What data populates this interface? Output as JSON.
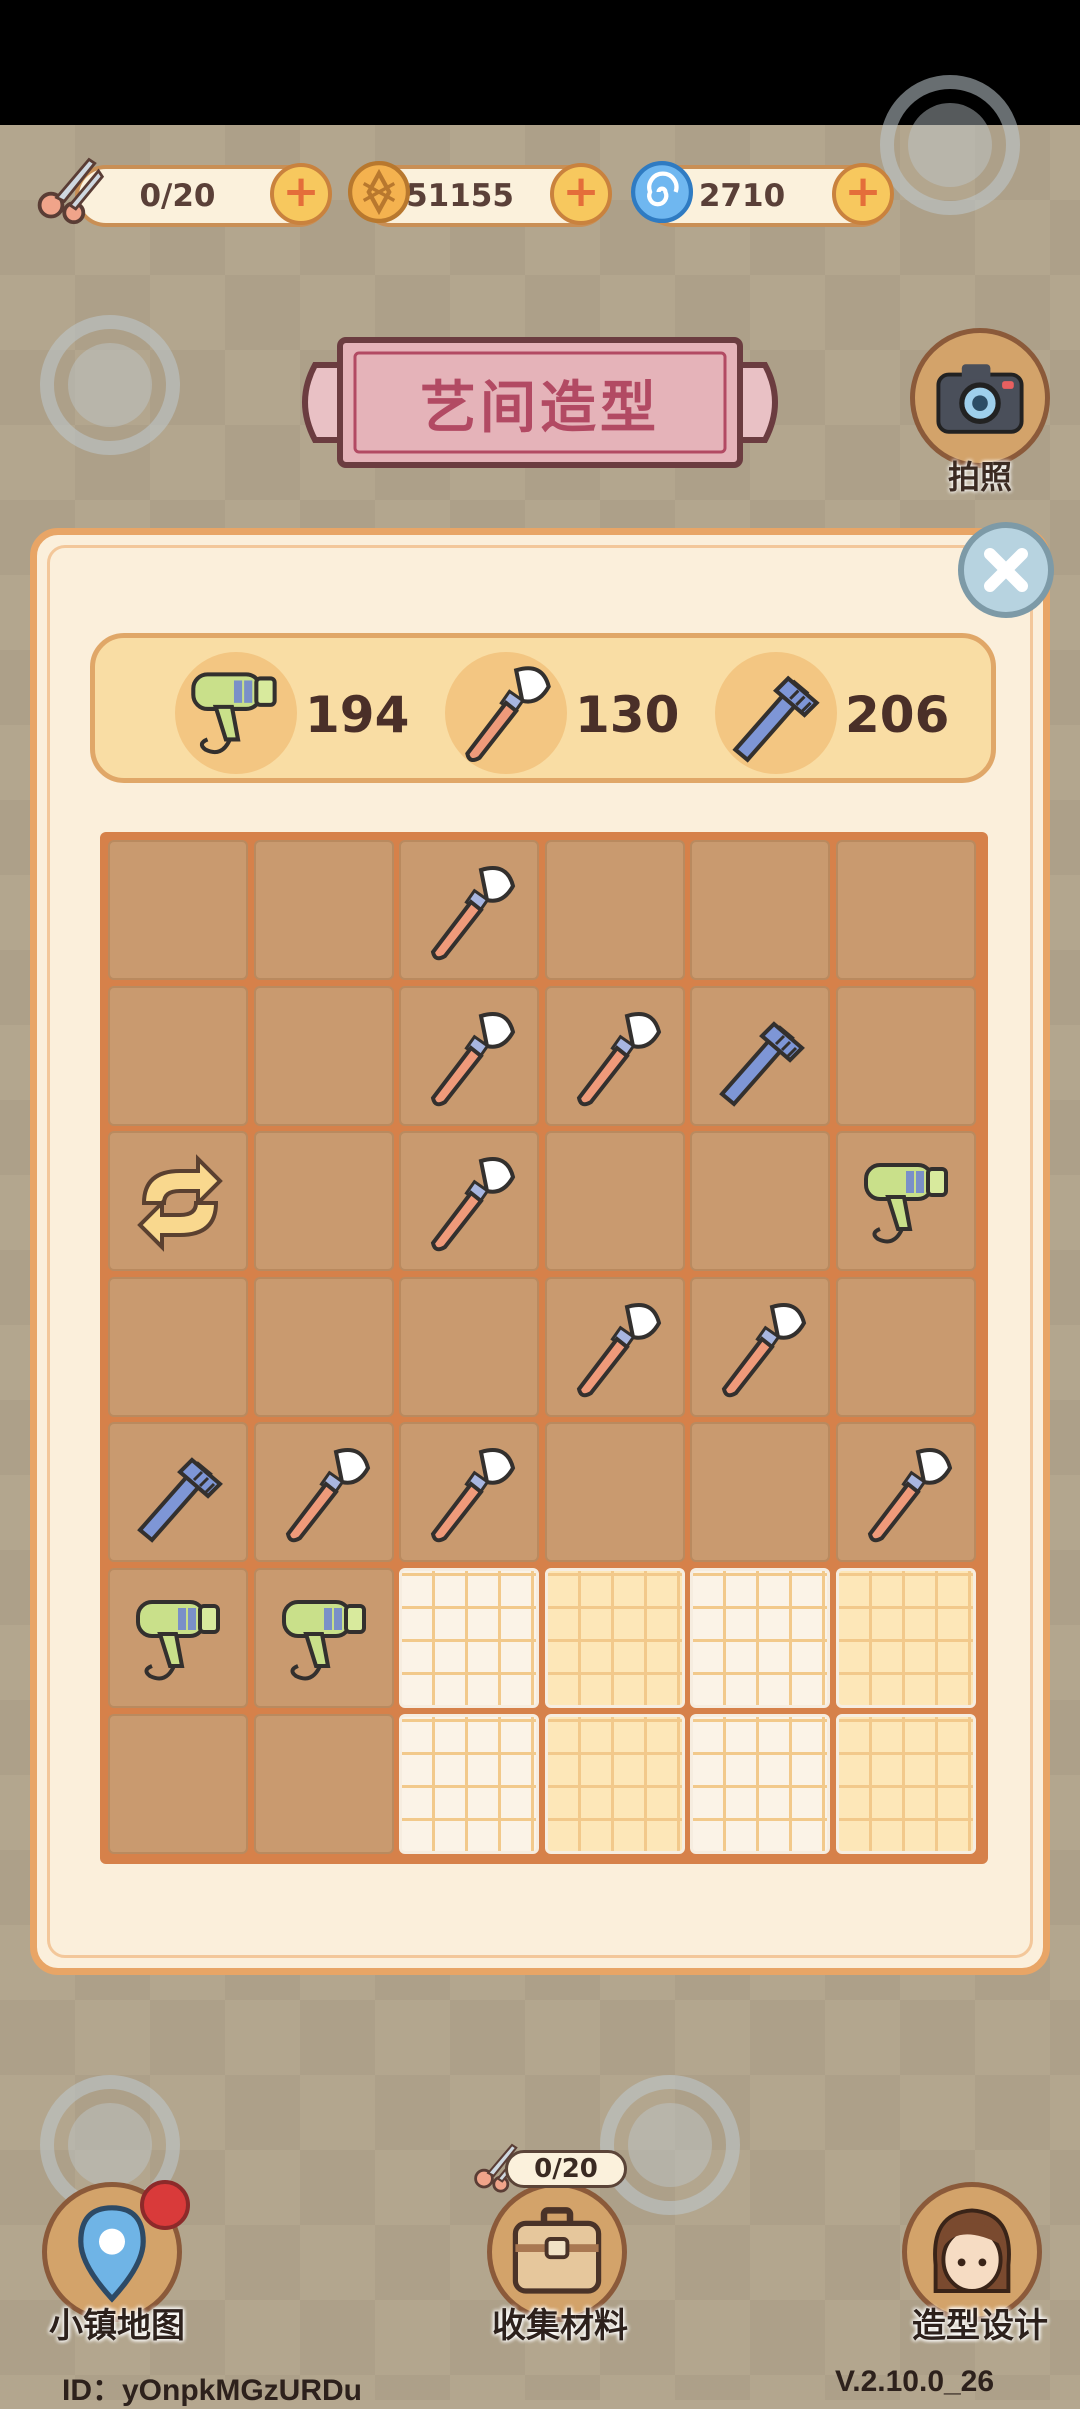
{
  "resources": {
    "scissors": {
      "value": "0/20",
      "icon": "scissors-icon"
    },
    "coins": {
      "value": "51155",
      "icon": "coin-icon"
    },
    "gems": {
      "value": "2710",
      "icon": "swirl-gem-icon"
    }
  },
  "title": "艺间造型",
  "camera": {
    "label": "拍照",
    "icon": "camera-icon"
  },
  "tools": [
    {
      "icon": "hair-dryer-icon",
      "count": "194"
    },
    {
      "icon": "makeup-brush-icon",
      "count": "130"
    },
    {
      "icon": "comb-icon",
      "count": "206"
    }
  ],
  "grid": {
    "rows": [
      [
        "empty",
        "empty",
        "brush",
        "empty",
        "empty",
        "empty"
      ],
      [
        "empty",
        "empty",
        "brush",
        "brush",
        "comb",
        "empty"
      ],
      [
        "refresh",
        "empty",
        "brush",
        "empty",
        "empty",
        "dryer"
      ],
      [
        "empty",
        "empty",
        "empty",
        "brush",
        "brush",
        "empty"
      ],
      [
        "comb",
        "brush",
        "brush",
        "empty",
        "empty",
        "brush"
      ],
      [
        "dryer",
        "dryer",
        "locked",
        "locked",
        "locked",
        "locked"
      ],
      [
        "empty",
        "empty",
        "locked",
        "locked",
        "locked",
        "locked"
      ]
    ]
  },
  "nav": {
    "map": {
      "label": "小镇地图",
      "icon": "map-pin-icon"
    },
    "collect": {
      "label": "收集材料",
      "icon": "suitcase-icon",
      "count": "0/20"
    },
    "design": {
      "label": "造型设计",
      "icon": "avatar-icon"
    }
  },
  "footer": {
    "id": "ID：yOnpkMGzURDu",
    "version": "V.2.10.0_26"
  },
  "colors": {
    "accent": "#e8a566",
    "title": "#b24a63",
    "cell": "#c99a6f",
    "grid_border": "#d6814a"
  }
}
